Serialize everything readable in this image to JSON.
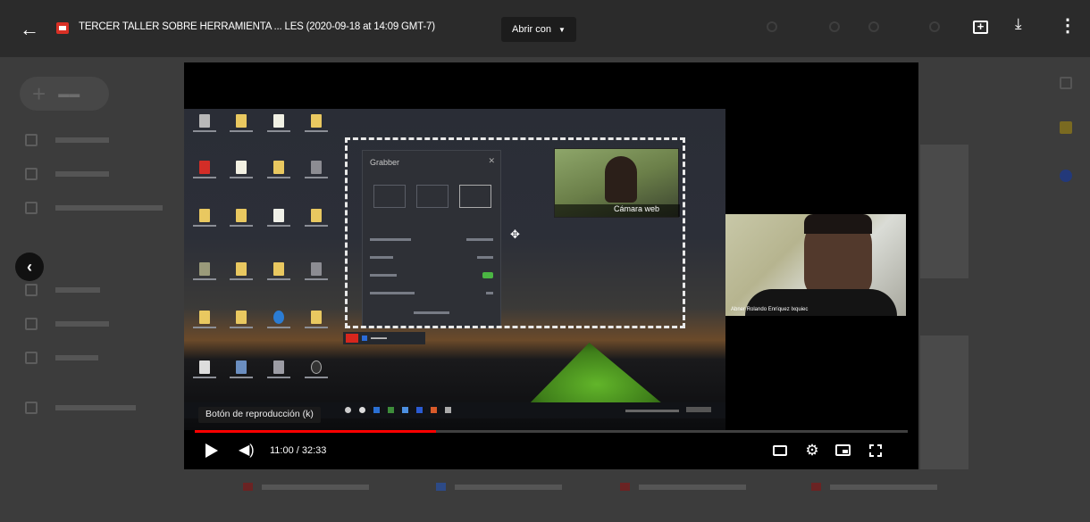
{
  "header": {
    "title": "TERCER TALLER SOBRE HERRAMIENTA ... LES (2020-09-18 at 14:09 GMT-7)",
    "open_with": "Abrir con",
    "icons": [
      "back-arrow-icon",
      "file-video-icon",
      "add-comment-icon",
      "download-icon",
      "more-vert-icon"
    ]
  },
  "player": {
    "tooltip": "Botón de reproducción (k)",
    "time": "11:00 / 32:33",
    "progress_fraction": 0.338,
    "progress_color": "#ff0000",
    "grabber_title": "Grabber",
    "camera_label": "Cámara web",
    "speaker_name": "Abner Rolando Enríquez Ixquiec"
  },
  "colors": {
    "topbar": "#2b2b2b",
    "overlay": "#3c3c3c",
    "accent_red": "#d93025"
  }
}
